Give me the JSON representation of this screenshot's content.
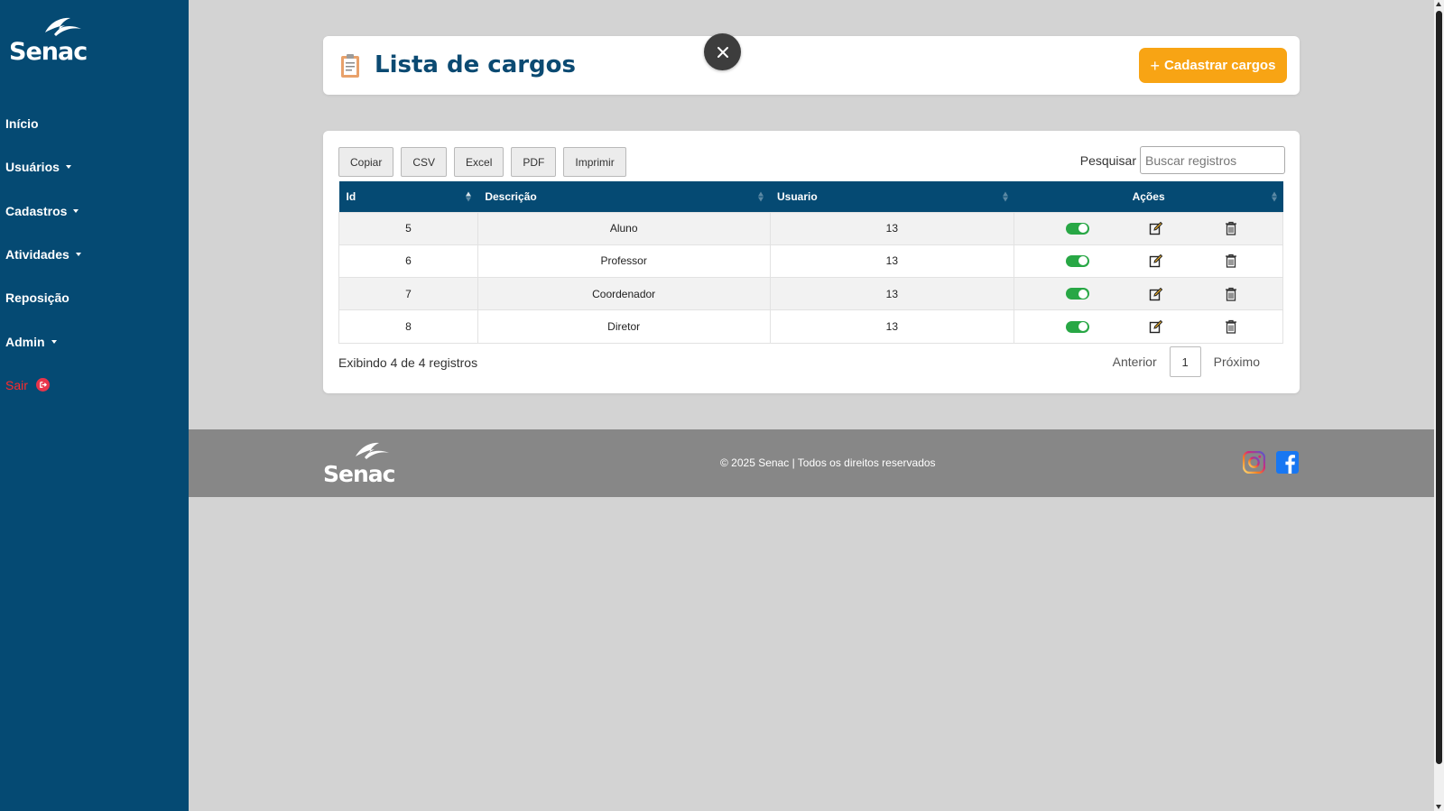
{
  "brand": {
    "name": "Senac"
  },
  "sidebar": {
    "items": [
      {
        "label": "Início",
        "has_dropdown": false
      },
      {
        "label": "Usuários",
        "has_dropdown": true
      },
      {
        "label": "Cadastros",
        "has_dropdown": true
      },
      {
        "label": "Atividades",
        "has_dropdown": true
      },
      {
        "label": "Reposição",
        "has_dropdown": false
      },
      {
        "label": "Admin",
        "has_dropdown": true
      },
      {
        "label": "Sair",
        "has_dropdown": false,
        "icon": "exit-icon"
      }
    ]
  },
  "header": {
    "title": "Lista de cargos",
    "add_button_label": "Cadastrar cargos",
    "icon": "clipboard-icon"
  },
  "toolbar": {
    "copy": "Copiar",
    "csv": "CSV",
    "excel": "Excel",
    "pdf": "PDF",
    "print": "Imprimir"
  },
  "search": {
    "label": "Pesquisar",
    "placeholder": "Buscar registros",
    "value": ""
  },
  "table": {
    "columns": [
      "Id",
      "Descrição",
      "Usuario",
      "Ações"
    ],
    "rows": [
      {
        "id": "5",
        "descricao": "Aluno",
        "usuario": "13",
        "active": true
      },
      {
        "id": "6",
        "descricao": "Professor",
        "usuario": "13",
        "active": true
      },
      {
        "id": "7",
        "descricao": "Coordenador",
        "usuario": "13",
        "active": true
      },
      {
        "id": "8",
        "descricao": "Diretor",
        "usuario": "13",
        "active": true
      }
    ]
  },
  "info": {
    "text": "Exibindo 4 de 4 registros"
  },
  "pagination": {
    "previous": "Anterior",
    "current": "1",
    "next": "Próximo"
  },
  "footer": {
    "copyright": "© 2025 Senac | Todos os direitos reservados",
    "social": [
      "instagram-icon",
      "facebook-icon"
    ]
  },
  "colors": {
    "sidebar": "#054a73",
    "accent": "#f8a414",
    "danger": "#ff2a2a",
    "toggle_on": "#28a745",
    "footer": "#878787"
  }
}
